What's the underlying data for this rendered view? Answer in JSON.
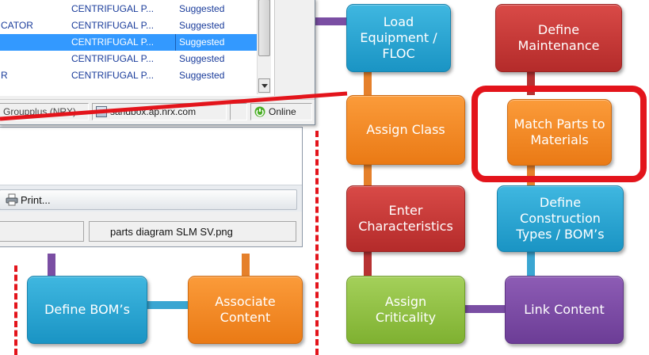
{
  "list_rows": [
    {
      "left_text": "",
      "class_text": "CENTRIFUGAL P...",
      "status": "Suggested",
      "selected": false
    },
    {
      "left_text": "CATOR",
      "class_text": "CENTRIFUGAL P...",
      "status": "Suggested",
      "selected": false
    },
    {
      "left_text": "",
      "class_text": "CENTRIFUGAL P...",
      "status": "Suggested",
      "selected": true
    },
    {
      "left_text": "",
      "class_text": "CENTRIFUGAL P...",
      "status": "Suggested",
      "selected": false
    },
    {
      "left_text": "R",
      "class_text": "CENTRIFUGAL P...",
      "status": "Suggested",
      "selected": false
    }
  ],
  "status_bar": {
    "left": "Groupplus (NRX)",
    "server": "sandbox.ap.nrx.com",
    "online": "Online"
  },
  "lower_window": {
    "print_label": "Print...",
    "filename": "parts diagram SLM SV.png"
  },
  "flow": {
    "load_equipment": "Load\nEquipment /\nFLOC",
    "define_maintenance": "Define\nMaintenance",
    "assign_class": "Assign Class",
    "match_parts": "Match Parts to\nMaterials",
    "enter_characteristics": "Enter\nCharacteristics",
    "define_construction": "Define\nConstruction\nTypes / BOM’s",
    "assign_criticality": "Assign\nCriticality",
    "link_content": "Link Content",
    "define_boms": "Define  BOM’s",
    "associate_content": "Associate\nContent"
  },
  "colors": {
    "highlight": "#e3141b",
    "blue": "#1a94c4",
    "red": "#b42b2a",
    "orange": "#ea7a15",
    "green": "#7fb131",
    "purple": "#6c3d96"
  }
}
